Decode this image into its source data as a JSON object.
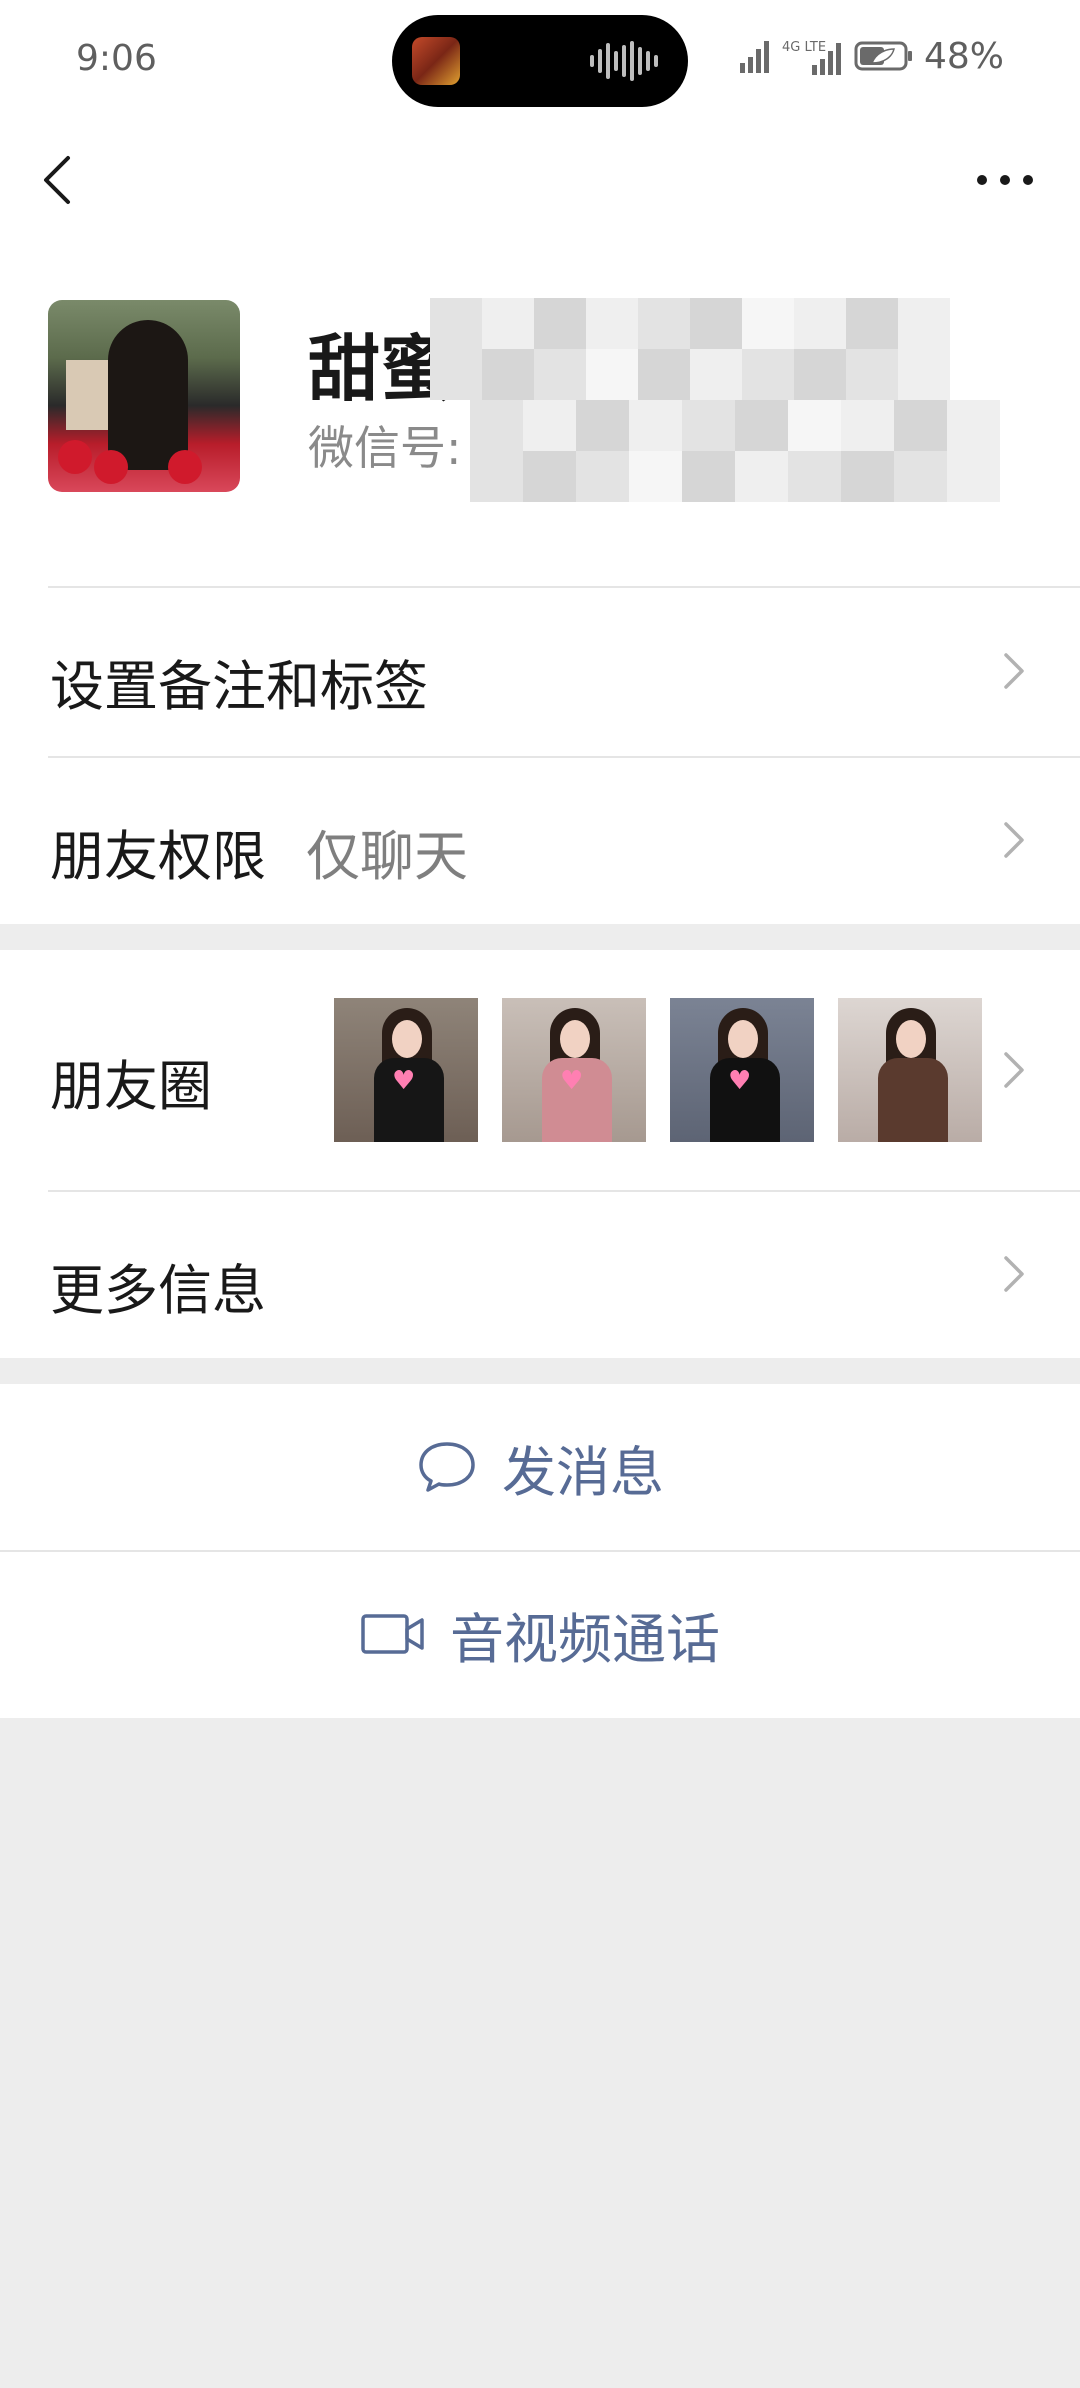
{
  "status_bar": {
    "time": "9:06",
    "network": "4G LTE",
    "battery_percent": "48%"
  },
  "nav": {
    "back_icon": "chevron-left-icon",
    "more_icon": "more-dots-icon"
  },
  "profile": {
    "name": "甜蜜蜜",
    "wechat_id_label": "微信号:"
  },
  "rows": {
    "remark_tags": {
      "label": "设置备注和标签"
    },
    "friend_permission": {
      "label": "朋友权限",
      "value": "仅聊天"
    },
    "moments": {
      "label": "朋友圈"
    },
    "more_info": {
      "label": "更多信息"
    }
  },
  "actions": {
    "send_message": {
      "label": "发消息",
      "icon": "chat-bubble-icon"
    },
    "video_call": {
      "label": "音视频通话",
      "icon": "video-camera-icon"
    }
  },
  "colors": {
    "link_blue": "#576b95",
    "background": "#ededed",
    "card": "#ffffff",
    "secondary_text": "#7f7f7f"
  }
}
